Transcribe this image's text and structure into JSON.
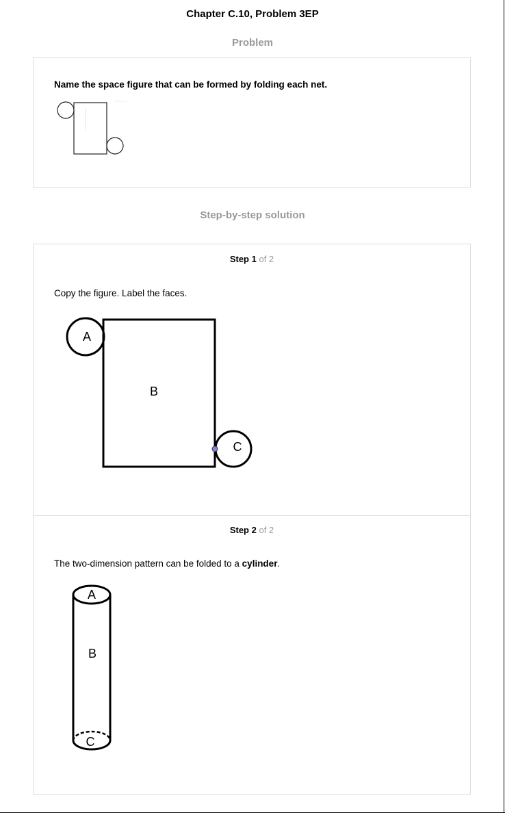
{
  "header": {
    "title": "Chapter C.10, Problem 3EP"
  },
  "problem": {
    "heading": "Problem",
    "statement": "Name the space figure that can be formed by folding each net."
  },
  "solution": {
    "heading": "Step-by-step solution",
    "steps": [
      {
        "label": "Step 1",
        "of": "of 2",
        "text": "Copy the figure. Label the faces.",
        "figure_labels": {
          "a": "A",
          "b": "B",
          "c": "C"
        }
      },
      {
        "label": "Step 2",
        "of": "of 2",
        "text_before": "The two-dimension pattern can be folded to a ",
        "text_bold": "cylinder",
        "text_after": ".",
        "figure_labels": {
          "a": "A",
          "b": "B",
          "c": "C"
        }
      }
    ]
  },
  "colors": {
    "muted": "#9a9a9a",
    "border": "#dcdcdc",
    "point": "#8080e0"
  }
}
